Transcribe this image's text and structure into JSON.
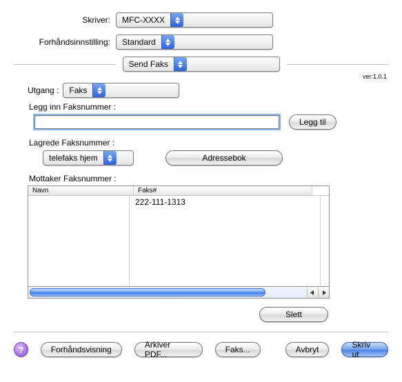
{
  "top": {
    "printerLabel": "Skriver:",
    "printerValue": "MFC-XXXX",
    "presetLabel": "Forhåndsinnstilling:",
    "presetValue": "Standard"
  },
  "panel": {
    "value": "Send Faks"
  },
  "version": "ver:1.0.1",
  "output": {
    "label": "Utgang :",
    "value": "Faks"
  },
  "enterFax": {
    "label": "Legg inn Faksnummer :",
    "value": "",
    "addBtn": "Legg til"
  },
  "storedFax": {
    "label": "Lagrede Faksnummer :",
    "value": "telefaks hjem",
    "addressbookBtn": "Adressebok"
  },
  "dest": {
    "label": "Mottaker Faksnummer :",
    "colName": "Navn",
    "colFax": "Faks#",
    "row1fax": "222-111-1313"
  },
  "deleteBtn": "Slett",
  "footer": {
    "preview": "Forhåndsvisning",
    "savePdf": "Arkiver PDF...",
    "fax": "Faks...",
    "cancel": "Avbryt",
    "print": "Skriv ut"
  }
}
